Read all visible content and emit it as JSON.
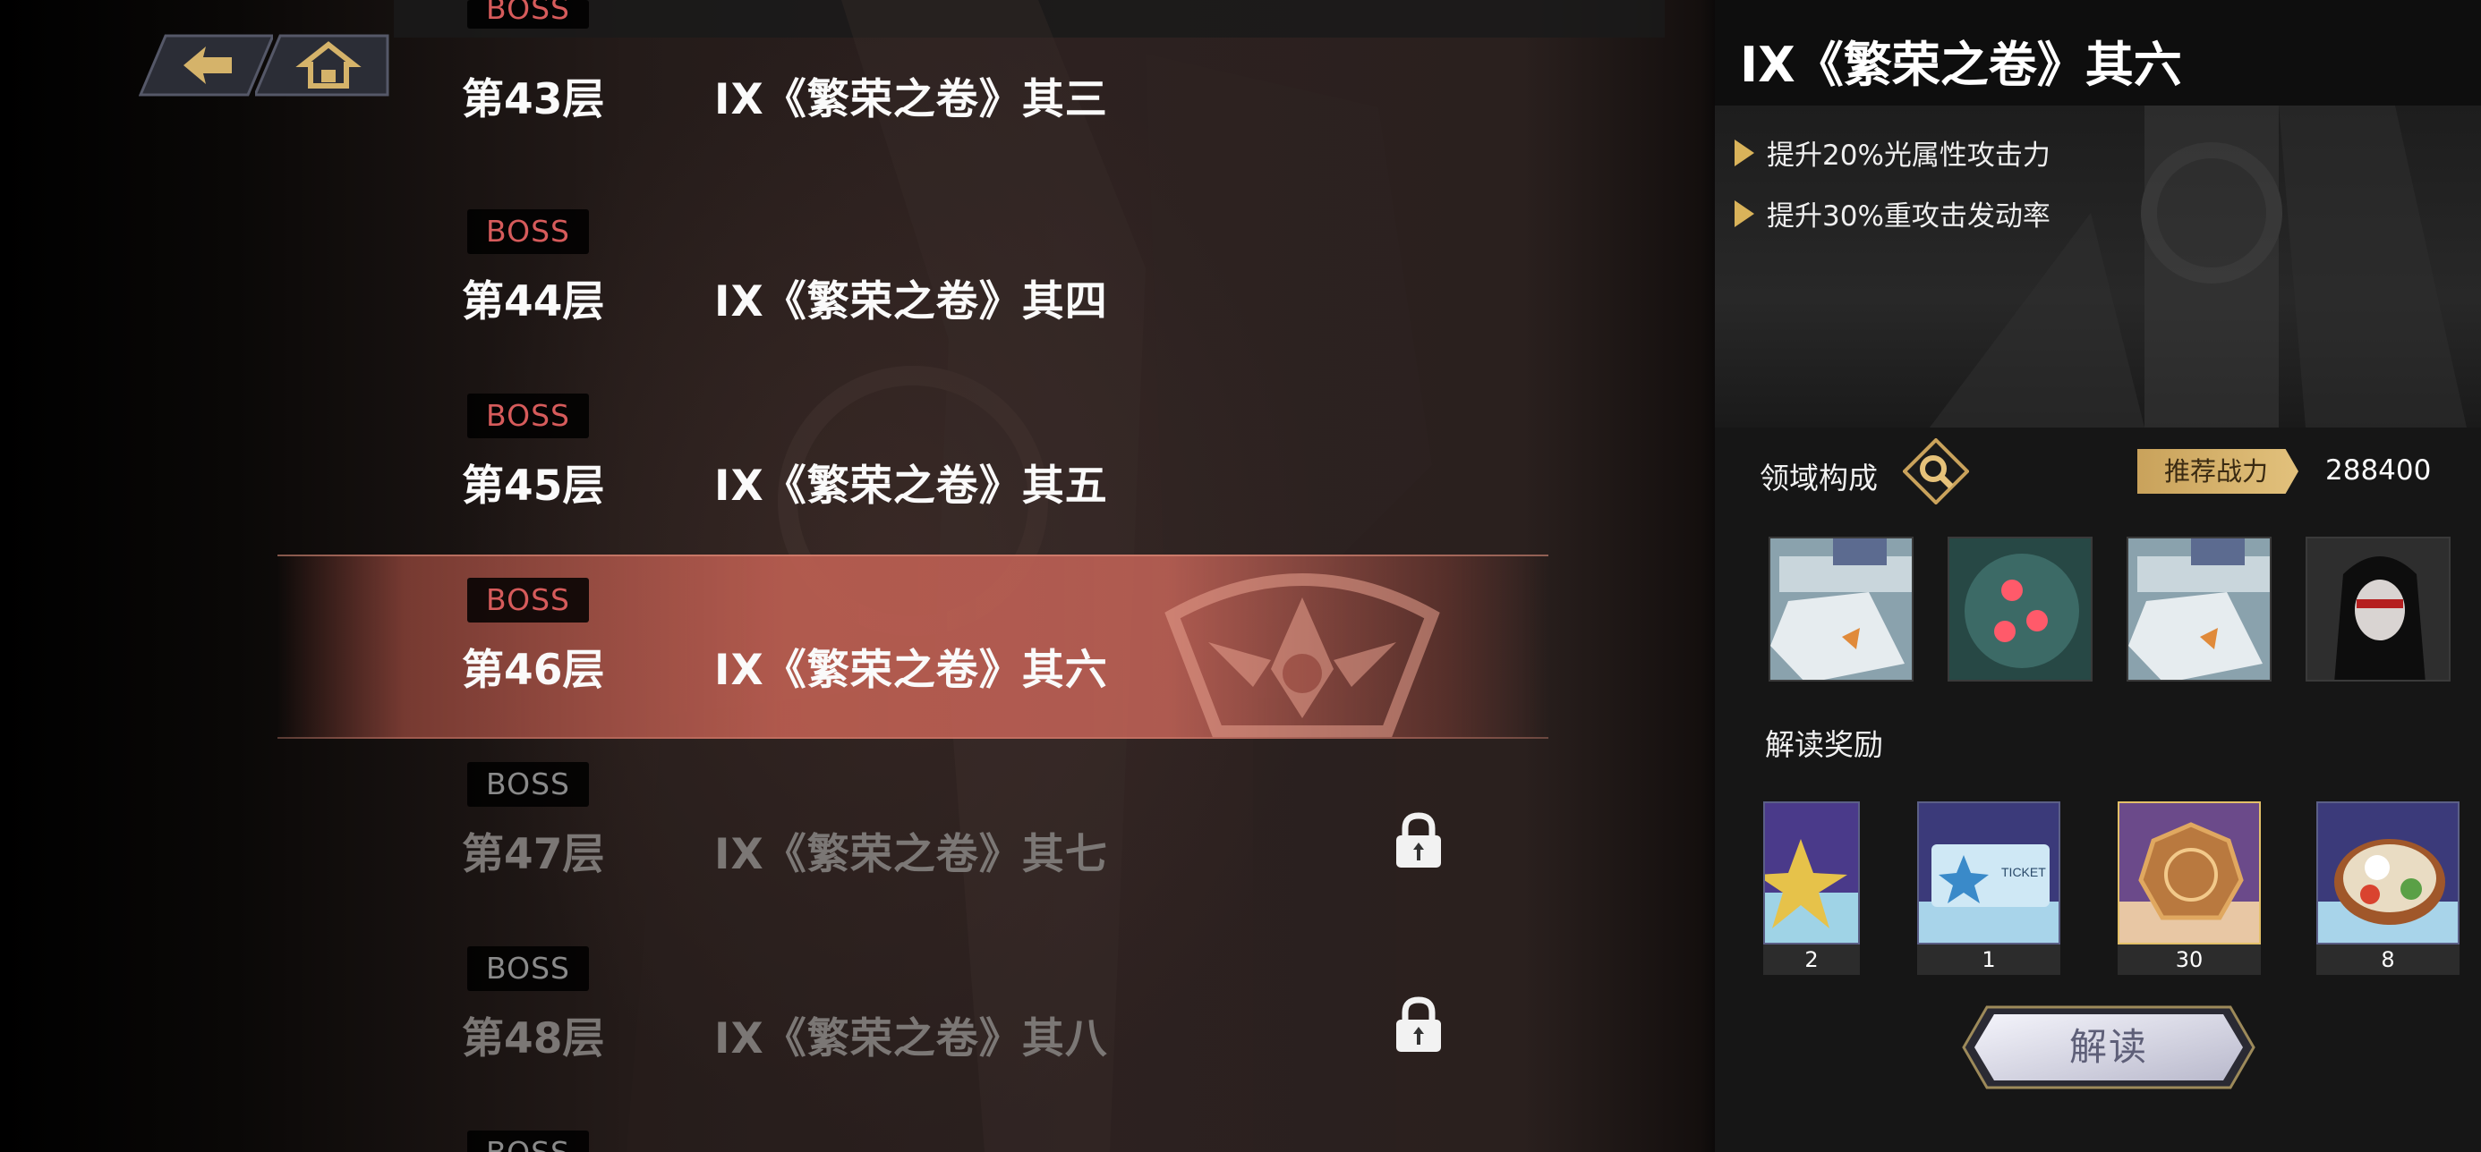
{
  "nav": {
    "back_icon": "back-arrow-icon",
    "home_icon": "home-icon",
    "accent": "#c9a25b"
  },
  "floors": [
    {
      "badge": "BOSS",
      "name": "第43层",
      "title": "IX《繁荣之卷》其三",
      "state": "cleared"
    },
    {
      "badge": "BOSS",
      "name": "第44层",
      "title": "IX《繁荣之卷》其四",
      "state": "cleared"
    },
    {
      "badge": "BOSS",
      "name": "第45层",
      "title": "IX《繁荣之卷》其五",
      "state": "cleared"
    },
    {
      "badge": "BOSS",
      "name": "第46层",
      "title": "IX《繁荣之卷》其六",
      "state": "selected"
    },
    {
      "badge": "BOSS",
      "name": "第47层",
      "title": "IX《繁荣之卷》其七",
      "state": "locked"
    },
    {
      "badge": "BOSS",
      "name": "第48层",
      "title": "IX《繁荣之卷》其八",
      "state": "locked"
    },
    {
      "badge": "BOSS",
      "name": "",
      "title": "",
      "state": "locked"
    }
  ],
  "detail": {
    "title": "IX《繁荣之卷》其六",
    "buffs": [
      "提升20%光属性攻击力",
      "提升30%重攻击发动率"
    ],
    "domain_label": "领域构成",
    "recommended_label": "推荐战力",
    "recommended_value": "288400",
    "enemies": [
      "mech-unit-icon",
      "drone-core-icon",
      "mech-unit-icon",
      "dark-hair-girl-icon"
    ],
    "reward_label": "解读奖励",
    "rewards": [
      {
        "icon": "star-emblem-icon",
        "count": "2"
      },
      {
        "icon": "ticket-icon",
        "count": "1"
      },
      {
        "icon": "gold-coin-icon",
        "count": "30"
      },
      {
        "icon": "bento-box-icon",
        "count": "8"
      }
    ],
    "read_button": "解读"
  },
  "colors": {
    "boss_red": "#d65b5b",
    "selected_row": "#c46458",
    "gold": "#d9b35a"
  }
}
